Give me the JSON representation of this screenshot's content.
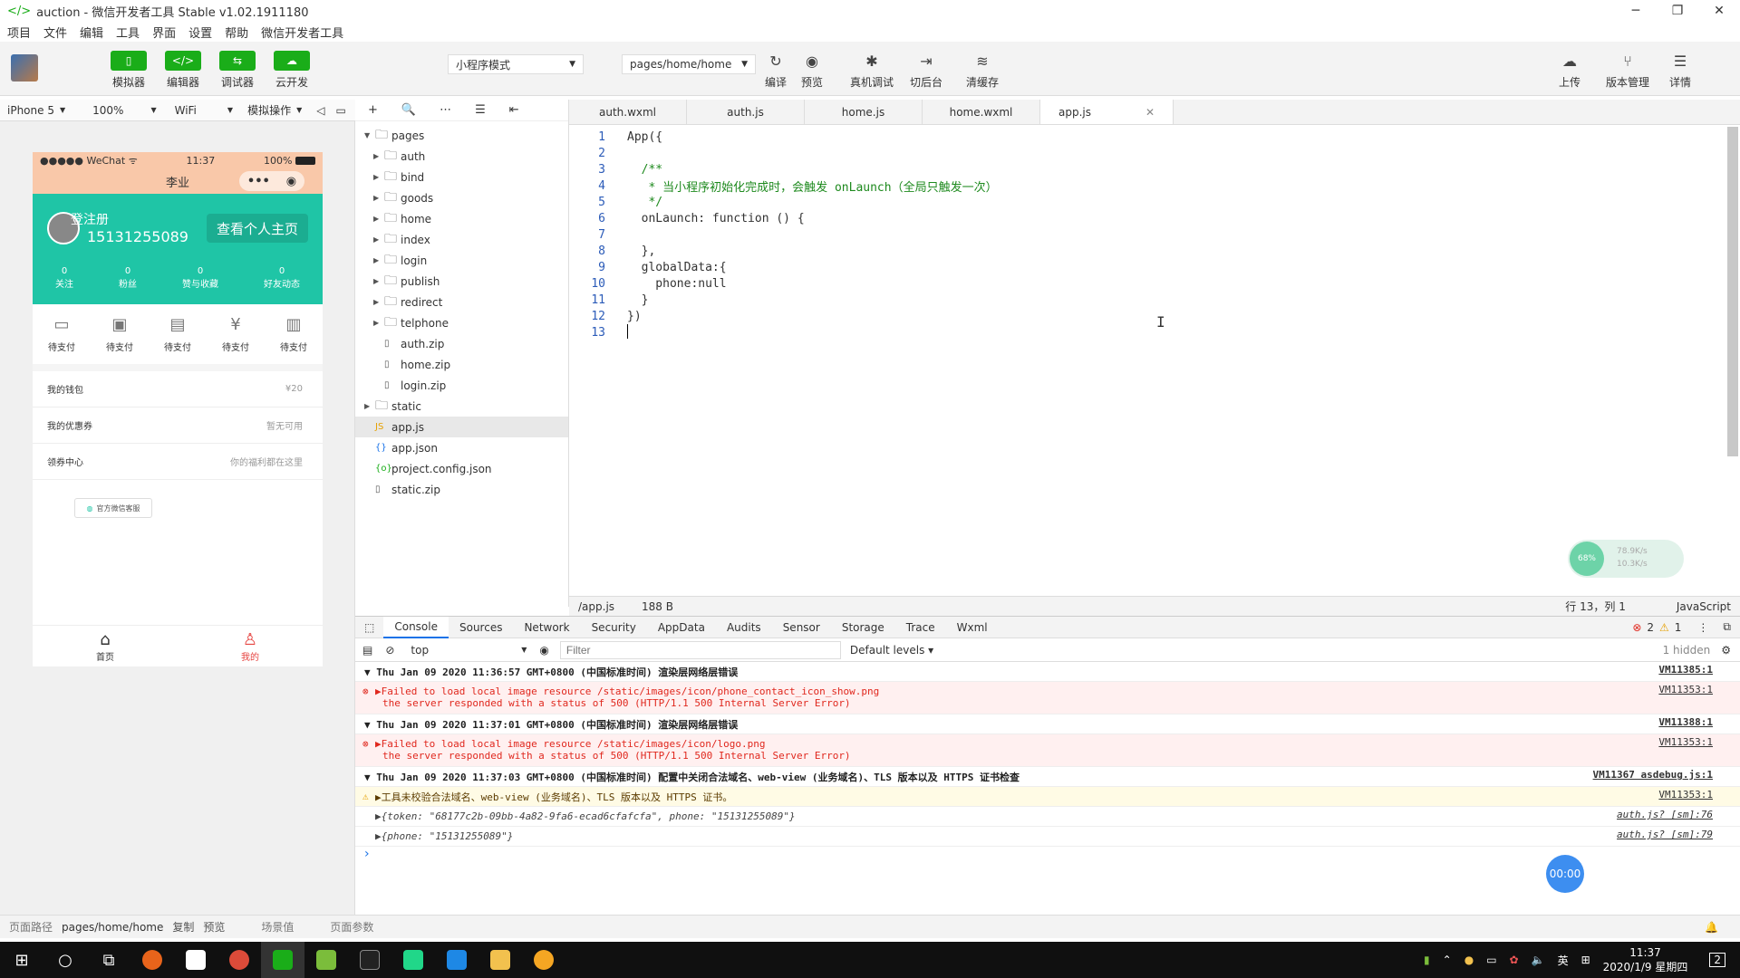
{
  "window": {
    "title": "auction - 微信开发者工具 Stable v1.02.1911180",
    "min": "─",
    "max": "❐",
    "close": "✕"
  },
  "menu": [
    "项目",
    "文件",
    "编辑",
    "工具",
    "界面",
    "设置",
    "帮助",
    "微信开发者工具"
  ],
  "toolbar": {
    "left": [
      {
        "label": "模拟器",
        "glyph": "▯"
      },
      {
        "label": "编辑器",
        "glyph": "</>"
      },
      {
        "label": "调试器",
        "glyph": "⇆"
      },
      {
        "label": "云开发",
        "glyph": "☁"
      }
    ],
    "mode": "小程序模式",
    "page": "pages/home/home",
    "right_mid": [
      {
        "label": "编译",
        "glyph": "↻"
      },
      {
        "label": "预览",
        "glyph": "◉"
      },
      {
        "label": "真机调试",
        "glyph": "✱"
      },
      {
        "label": "切后台",
        "glyph": "⇥"
      },
      {
        "label": "清缓存",
        "glyph": "≋"
      }
    ],
    "right": [
      {
        "label": "上传",
        "glyph": "☁"
      },
      {
        "label": "版本管理",
        "glyph": "⑂"
      },
      {
        "label": "详情",
        "glyph": "☰"
      }
    ]
  },
  "device_bar": {
    "device": "iPhone 5",
    "zoom": "100%",
    "network": "WiFi",
    "sim_ops": "模拟操作"
  },
  "phone": {
    "status": {
      "carrier": "●●●●● WeChat",
      "wifi": "ᯤ",
      "time": "11:37",
      "battery": "100%"
    },
    "nav_title": "李业",
    "header": {
      "register": "登注册",
      "phone": "15131255089",
      "home_button": "查看个人主页"
    },
    "stats": [
      {
        "count": "0",
        "label": "关注"
      },
      {
        "count": "0",
        "label": "粉丝"
      },
      {
        "count": "0",
        "label": "赞与收藏"
      },
      {
        "count": "0",
        "label": "好友动态"
      }
    ],
    "orders": [
      {
        "label": "待支付",
        "glyph": "▭"
      },
      {
        "label": "待支付",
        "glyph": "▣"
      },
      {
        "label": "待支付",
        "glyph": "▤"
      },
      {
        "label": "待支付",
        "glyph": "¥"
      },
      {
        "label": "待支付",
        "glyph": "▥"
      }
    ],
    "list": [
      {
        "label": "我的钱包",
        "value": "¥20"
      },
      {
        "label": "我的优惠券",
        "value": "暂无可用"
      },
      {
        "label": "领券中心",
        "value": "你的福利都在这里"
      }
    ],
    "service": "官方微信客服",
    "tabs": [
      {
        "label": "首页",
        "glyph": "⌂"
      },
      {
        "label": "我的",
        "glyph": "♙"
      }
    ]
  },
  "filetree": {
    "tools": [
      "+",
      "🔍",
      "⋯",
      "☰",
      "⇤"
    ],
    "items": [
      {
        "name": "pages",
        "type": "folder",
        "open": true,
        "depth": 0
      },
      {
        "name": "auth",
        "type": "folder",
        "depth": 1
      },
      {
        "name": "bind",
        "type": "folder",
        "depth": 1
      },
      {
        "name": "goods",
        "type": "folder",
        "depth": 1
      },
      {
        "name": "home",
        "type": "folder",
        "depth": 1
      },
      {
        "name": "index",
        "type": "folder",
        "depth": 1
      },
      {
        "name": "login",
        "type": "folder",
        "depth": 1
      },
      {
        "name": "publish",
        "type": "folder",
        "depth": 1
      },
      {
        "name": "redirect",
        "type": "folder",
        "depth": 1
      },
      {
        "name": "telphone",
        "type": "folder",
        "depth": 1
      },
      {
        "name": "auth.zip",
        "type": "file",
        "depth": 1
      },
      {
        "name": "home.zip",
        "type": "file",
        "depth": 1
      },
      {
        "name": "login.zip",
        "type": "file",
        "depth": 1
      },
      {
        "name": "static",
        "type": "folder",
        "depth": 0
      },
      {
        "name": "app.js",
        "type": "js",
        "depth": 0,
        "selected": true
      },
      {
        "name": "app.json",
        "type": "json",
        "depth": 0
      },
      {
        "name": "project.config.json",
        "type": "config",
        "depth": 0
      },
      {
        "name": "static.zip",
        "type": "file",
        "depth": 0
      }
    ]
  },
  "editor": {
    "tabs": [
      "auth.wxml",
      "auth.js",
      "home.js",
      "home.wxml",
      "app.js"
    ],
    "active_tab": "app.js",
    "lines": [
      "App({",
      "",
      "  /**",
      "   * 当小程序初始化完成时，会触发 onLaunch（全局只触发一次）",
      "   */",
      "  onLaunch: function () {",
      "",
      "  },",
      "  globalData:{",
      "    phone:null",
      "  }",
      "})",
      ""
    ],
    "status": {
      "path": "/app.js",
      "size": "188 B",
      "cursor": "行 13，列 1",
      "lang": "JavaScript"
    }
  },
  "network_widget": {
    "percent": "68%",
    "up": "78.9K/s",
    "down": "10.3K/s"
  },
  "devtools": {
    "tabs": [
      "Console",
      "Sources",
      "Network",
      "Security",
      "AppData",
      "Audits",
      "Sensor",
      "Storage",
      "Trace",
      "Wxml"
    ],
    "errors": "2",
    "warnings": "1",
    "context": "top",
    "filter_placeholder": "Filter",
    "levels": "Default levels",
    "hidden": "1 hidden",
    "messages": [
      {
        "kind": "grp",
        "text": "▼ Thu Jan 09 2020 11:36:57 GMT+0800 (中国标准时间) 渲染层网络层错误",
        "src": "VM11385:1"
      },
      {
        "kind": "err",
        "text": "▶Failed to load local image resource /static/images/icon/phone_contact_icon_show.png",
        "text2": "the server responded with a status of 500 (HTTP/1.1 500 Internal Server Error)",
        "src": "VM11353:1"
      },
      {
        "kind": "grp",
        "text": "▼ Thu Jan 09 2020 11:37:01 GMT+0800 (中国标准时间) 渲染层网络层错误",
        "src": "VM11388:1"
      },
      {
        "kind": "err",
        "text": "▶Failed to load local image resource /static/images/icon/logo.png",
        "text2": "the server responded with a status of 500 (HTTP/1.1 500 Internal Server Error)",
        "src": "VM11353:1"
      },
      {
        "kind": "grp",
        "text": "▼ Thu Jan 09 2020 11:37:03 GMT+0800 (中国标准时间) 配置中关闭合法域名、web-view (业务域名)、TLS 版本以及 HTTPS 证书检查",
        "src": "VM11367 asdebug.js:1"
      },
      {
        "kind": "warn",
        "text": "▶工具未校验合法域名、web-view (业务域名)、TLS 版本以及 HTTPS 证书。",
        "src": "VM11353:1"
      },
      {
        "kind": "obj",
        "text": "▶{token: \"68177c2b-09bb-4a82-9fa6-ecad6cfafcfa\", phone: \"15131255089\"}",
        "src": "auth.js? [sm]:76"
      },
      {
        "kind": "obj",
        "text": "▶{phone: \"15131255089\"}",
        "src": "auth.js? [sm]:79"
      }
    ],
    "prompt": "›"
  },
  "timer": "00:00",
  "statusbar": {
    "path_label": "页面路径",
    "path": "pages/home/home",
    "copy": "复制",
    "preview": "预览",
    "scene": "场景值",
    "params": "页面参数"
  },
  "taskbar": {
    "time": "11:37",
    "date": "2020/1/9 星期四",
    "ime": "英",
    "notif": "2"
  }
}
